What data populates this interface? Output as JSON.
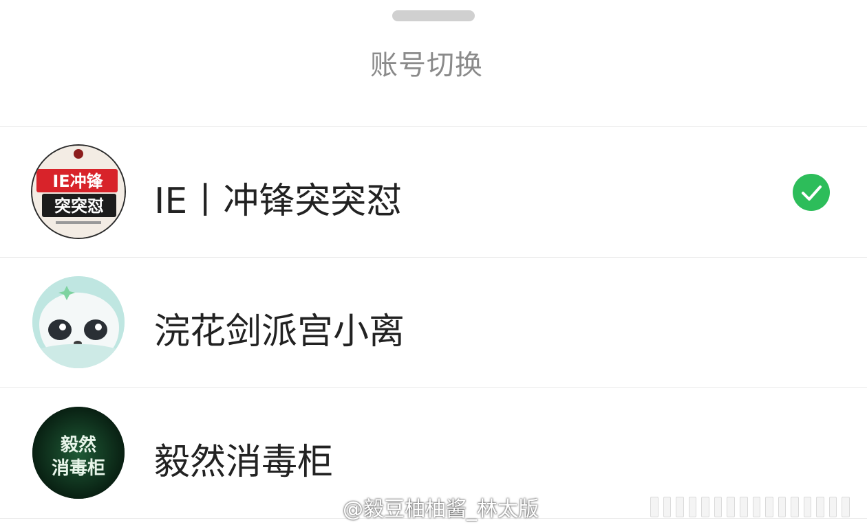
{
  "sheet": {
    "title": "账号切换"
  },
  "accounts": [
    {
      "name": "IE丨冲锋突突怼",
      "selected": true,
      "avatar_text_top": "IE冲锋",
      "avatar_text_bottom": "突突怼",
      "avatar_icon": "ie-team-logo-icon"
    },
    {
      "name": "浣花剑派宫小离",
      "selected": false,
      "avatar_icon": "panda-cartoon-icon"
    },
    {
      "name": "毅然消毒柜",
      "selected": false,
      "avatar_text_top": "毅然",
      "avatar_text_bottom": "消毒柜",
      "avatar_icon": "green-text-logo-icon"
    }
  ],
  "watermark": {
    "text": "@毅豆柚柚酱_林太版"
  },
  "colors": {
    "check_green": "#2dbd5a",
    "title_gray": "#8a8a8a",
    "name_text": "#222222"
  }
}
